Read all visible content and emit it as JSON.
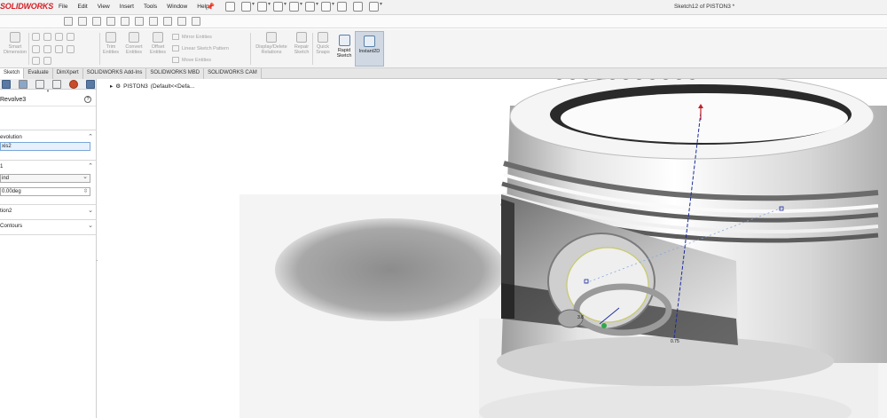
{
  "app": {
    "logo": "SOLIDWORKS",
    "doc_title": "Sketch12 of PISTON3 *"
  },
  "menu": [
    "File",
    "Edit",
    "View",
    "Insert",
    "Tools",
    "Window",
    "Help"
  ],
  "commands": {
    "smart_dimension": "Smart Dimension",
    "trim": "Trim Entities",
    "convert": "Convert Entities",
    "offset": "Offset Entities",
    "mirror": "Mirror Entities",
    "linear_pattern": "Linear Sketch Pattern",
    "move": "Move Entities",
    "display_delete": "Display/Delete Relations",
    "repair": "Repair Sketch",
    "quick_snaps": "Quick Snaps",
    "rapid_sketch": "Rapid Sketch",
    "instant2d": "Instant2D"
  },
  "tabs": [
    "Sketch",
    "Evaluate",
    "DimXpert",
    "SOLIDWORKS Add-Ins",
    "SOLIDWORKS MBD",
    "SOLIDWORKS CAM"
  ],
  "property_manager": {
    "title": "Revolve3",
    "help": "?",
    "axis_section": "evolution",
    "axis_value": "xis2",
    "direction_section": "1",
    "end_condition": "ind",
    "angle": "0.00deg",
    "direction2": "tion2",
    "contours": "Contours"
  },
  "tree": {
    "root": "PISTON3",
    "config": "(Default<<Defa..."
  },
  "sketch_labels": {
    "dim_a": "3.8",
    "dim_b": "0.75"
  },
  "colors": {
    "logo_red": "#d22027",
    "active_blue": "#cfd8e3",
    "field_blue": "#e6f1fb",
    "axis_blue": "#1a2a9c",
    "axis_red": "#c0202a"
  }
}
